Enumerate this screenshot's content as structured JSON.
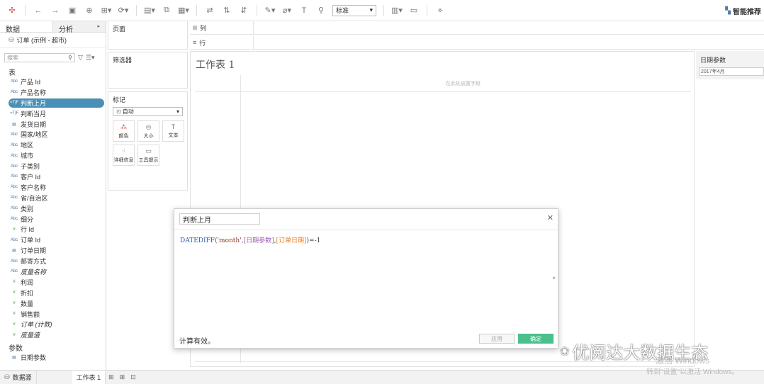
{
  "toolbar": {
    "mark_type_select": "标准",
    "right_label": "智能推荐"
  },
  "left_pane": {
    "tabs": [
      {
        "label": "数据"
      },
      {
        "label": "分析"
      }
    ],
    "datasource": "订单 (示例 - 超市)",
    "search_placeholder": "搜索",
    "tables_header": "表",
    "fields": [
      {
        "icon": "Abc",
        "label": "产品 Id"
      },
      {
        "icon": "Abc",
        "label": "产品名称"
      },
      {
        "icon": "=T|F",
        "label": "判断上月"
      },
      {
        "icon": "=T|F",
        "label": "判断当月"
      },
      {
        "icon": "cal",
        "label": "发货日期"
      },
      {
        "icon": "Abc",
        "label": "国家/地区"
      },
      {
        "icon": "Abc",
        "label": "地区"
      },
      {
        "icon": "Abc",
        "label": "城市"
      },
      {
        "icon": "Abc",
        "label": "子类别"
      },
      {
        "icon": "Abc",
        "label": "客户 Id"
      },
      {
        "icon": "Abc",
        "label": "客户名称"
      },
      {
        "icon": "Abc",
        "label": "省/自治区"
      },
      {
        "icon": "Abc",
        "label": "类别"
      },
      {
        "icon": "Abc",
        "label": "细分"
      },
      {
        "icon": "#",
        "label": "行 Id"
      },
      {
        "icon": "Abc",
        "label": "订单 Id"
      },
      {
        "icon": "cal",
        "label": "订单日期"
      },
      {
        "icon": "Abc",
        "label": "邮寄方式"
      },
      {
        "icon": "Abc",
        "label": "度量名称"
      },
      {
        "icon": "#",
        "label": "利润"
      },
      {
        "icon": "#",
        "label": "折扣"
      },
      {
        "icon": "#",
        "label": "数量"
      },
      {
        "icon": "#",
        "label": "销售额"
      },
      {
        "icon": "#",
        "label": "订单 (计数)"
      },
      {
        "icon": "#",
        "label": "度量值"
      }
    ],
    "params_header": "参数",
    "params": [
      {
        "icon": "cal",
        "label": "日期参数"
      }
    ]
  },
  "shelves": {
    "pages": "页面",
    "filters": "筛选器",
    "marks": "标记",
    "marks_type": "自动",
    "mark_buttons": [
      {
        "label": "颜色"
      },
      {
        "label": "大小"
      },
      {
        "label": "文本"
      },
      {
        "label": "详细信息"
      },
      {
        "label": "工具提示"
      }
    ],
    "columns": "列",
    "rows": "行"
  },
  "canvas": {
    "sheet_title": "工作表 1",
    "drop_hint": "在此处放置字段"
  },
  "parameter_card": {
    "title": "日期参数",
    "value": "2017年4月"
  },
  "calc_dialog": {
    "name": "判断上月",
    "formula": {
      "func": "DATEDIFF",
      "open": "(",
      "arg_str": "'month'",
      "comma1": ",",
      "arg_param": "[日期参数]",
      "comma2": ",",
      "arg_field": "[订单日期]",
      "close": ")=-1"
    },
    "status": "计算有效。",
    "apply_label": "应用",
    "ok_label": "确定"
  },
  "statusbar": {
    "datasource": "数据源",
    "sheet": "工作表 1"
  },
  "watermarks": {
    "win1": "激活 Windows",
    "win2": "转到\"设置\"以激活 Windows。",
    "brand": "优阅达大数据生态"
  }
}
